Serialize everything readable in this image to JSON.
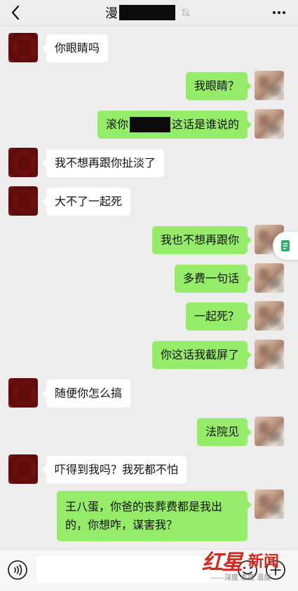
{
  "header": {
    "title_visible": "漫",
    "title_redacted": true
  },
  "messages": [
    {
      "side": "left",
      "text": "你眼睛吗"
    },
    {
      "side": "right",
      "text": "我眼睛？"
    },
    {
      "side": "right",
      "text_before": "滚你",
      "text_after": "这话是谁说的",
      "redacted": true
    },
    {
      "side": "left",
      "text": "我不想再跟你扯淡了"
    },
    {
      "side": "left",
      "text": "大不了一起死"
    },
    {
      "side": "right",
      "text": "我也不想再跟你"
    },
    {
      "side": "right",
      "text": "多费一句话"
    },
    {
      "side": "right",
      "text": "一起死？"
    },
    {
      "side": "right",
      "text": "你这话我截屏了"
    },
    {
      "side": "left",
      "text": "随便你怎么搞"
    },
    {
      "side": "right",
      "text": "法院见"
    },
    {
      "side": "left",
      "text": "吓得到我吗？我死都不怕"
    },
    {
      "side": "right",
      "text": "王八蛋，你爸的丧葬费都是我出的，你想咋，谋害我？"
    }
  ],
  "watermark": {
    "brand_red": "红星",
    "brand_news": "新闻",
    "slogan": "——深度 态度 温度"
  },
  "colors": {
    "bubble_right": "#95ec69",
    "bubble_left": "#ffffff",
    "background": "#ededed",
    "watermark": "#d7261d"
  }
}
